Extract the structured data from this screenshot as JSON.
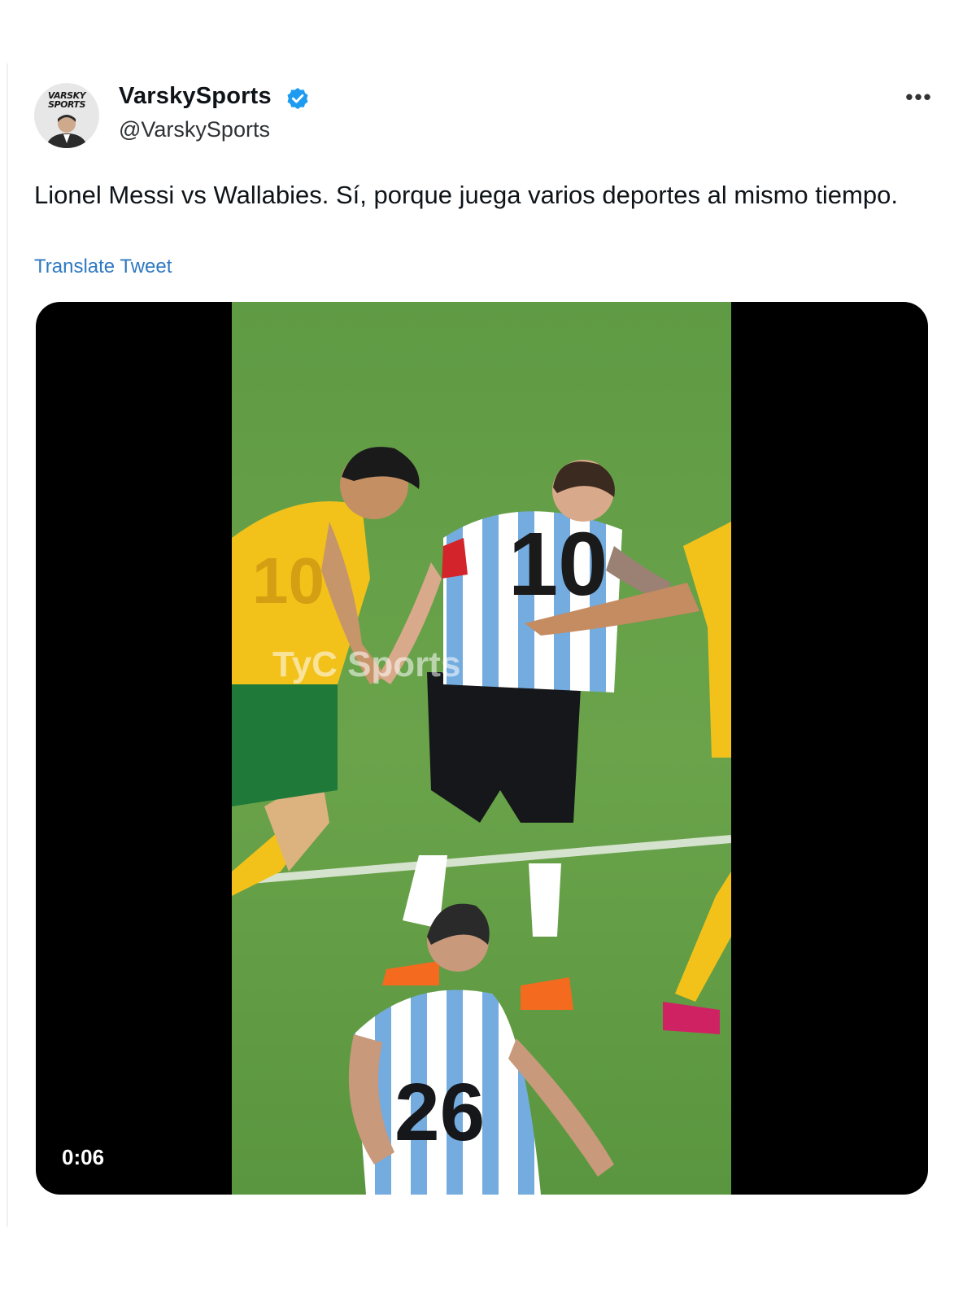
{
  "tweet": {
    "avatar": {
      "logo_line1": "VARSKY",
      "logo_line2": "SPORTS"
    },
    "display_name": "VarskySports",
    "handle": "@VarskySports",
    "more_label": "•••",
    "text": "Lionel Messi vs Wallabies. Sí, porque juega varios deportes al mismo tiempo.",
    "translate_label": "Translate Tweet"
  },
  "media": {
    "timestamp": "0:06",
    "watermark": "TyC Sports",
    "jersey_numbers": [
      "10",
      "10",
      "26"
    ]
  },
  "colors": {
    "link": "#2f79c2",
    "verified": "#1d9bf0",
    "pitch": "#5d9a3f",
    "australia_yellow": "#f2c21b",
    "australia_green": "#1f7a3a",
    "argentina_blue": "#74acdf"
  }
}
